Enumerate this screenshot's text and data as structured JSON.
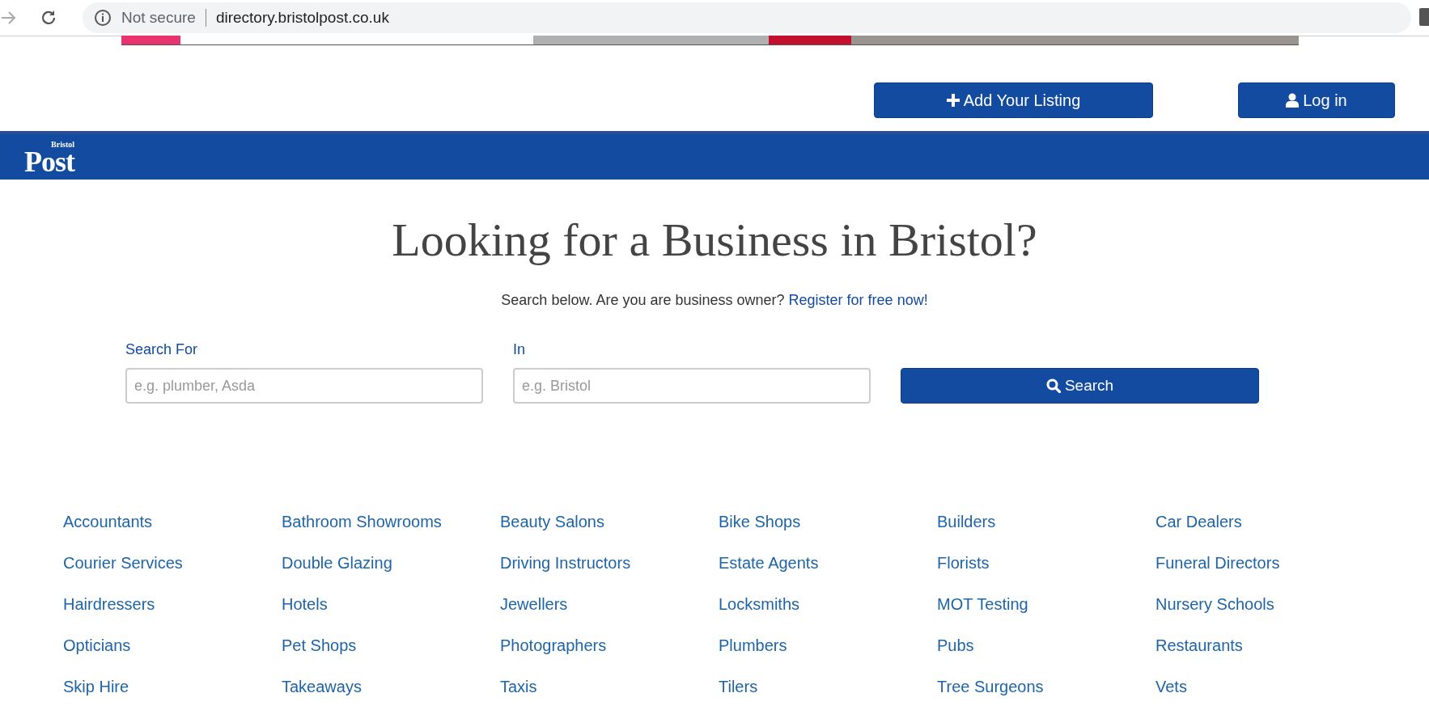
{
  "browser": {
    "security_label": "Not secure",
    "url": "directory.bristolpost.co.uk"
  },
  "header_buttons": [
    {
      "label": "Add Your Listing",
      "kind": "add"
    },
    {
      "label": "Log in",
      "kind": "login"
    }
  ],
  "logo": {
    "small": "Bristol",
    "main": "Post"
  },
  "hero": {
    "heading": "Looking for a Business in Bristol?",
    "intro": "Search below. Are you are business owner?",
    "intro_link": "Register for free now!"
  },
  "search": {
    "fields": [
      {
        "label": "Search For",
        "placeholder": "e.g. plumber, Asda"
      },
      {
        "label": "In",
        "placeholder": "e.g. Bristol"
      }
    ],
    "button": "Search"
  },
  "categories": [
    "Accountants",
    "Bathroom Showrooms",
    "Beauty Salons",
    "Bike Shops",
    "Builders",
    "Car Dealers",
    "Courier Services",
    "Double Glazing",
    "Driving Instructors",
    "Estate Agents",
    "Florists",
    "Funeral Directors",
    "Hairdressers",
    "Hotels",
    "Jewellers",
    "Locksmiths",
    "MOT Testing",
    "Nursery Schools",
    "Opticians",
    "Pet Shops",
    "Photographers",
    "Plumbers",
    "Pubs",
    "Restaurants",
    "Skip Hire",
    "Takeaways",
    "Taxis",
    "Tilers",
    "Tree Surgeons",
    "Vets"
  ]
}
